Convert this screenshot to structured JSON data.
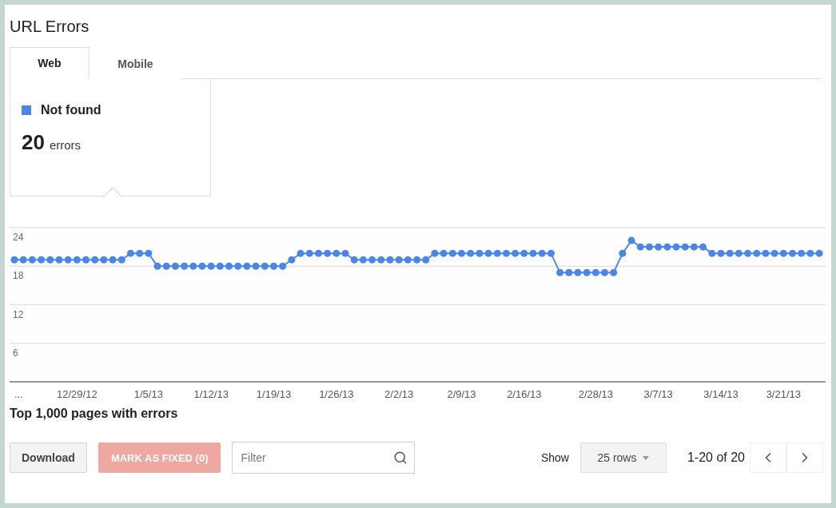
{
  "title": "URL Errors",
  "tabs": [
    {
      "label": "Web",
      "selected": true
    },
    {
      "label": "Mobile",
      "selected": false
    }
  ],
  "legend": {
    "count": "20",
    "unit": "errors"
  },
  "chart_data": {
    "type": "line",
    "grid": true,
    "ylim": [
      0,
      24
    ],
    "yticks": [
      6,
      12,
      18,
      24
    ],
    "categories": [
      "...",
      null,
      null,
      null,
      null,
      null,
      null,
      "12/29/12",
      null,
      null,
      null,
      null,
      null,
      null,
      null,
      "1/5/13",
      null,
      null,
      null,
      null,
      null,
      null,
      "1/12/13",
      null,
      null,
      null,
      null,
      null,
      null,
      "1/19/13",
      null,
      null,
      null,
      null,
      null,
      null,
      "1/26/13",
      null,
      null,
      null,
      null,
      null,
      null,
      "2/2/13",
      null,
      null,
      null,
      null,
      null,
      null,
      "2/9/13",
      null,
      null,
      null,
      null,
      null,
      null,
      "2/16/13",
      null,
      null,
      null,
      null,
      null,
      null,
      null,
      "2/28/13",
      null,
      null,
      null,
      null,
      null,
      null,
      "3/7/13",
      null,
      null,
      null,
      null,
      null,
      null,
      "3/14/13",
      null,
      null,
      null,
      null,
      null,
      null,
      "3/21/13",
      null,
      null,
      null,
      null
    ],
    "series": [
      {
        "name": "Not found",
        "color": "#4a86e8",
        "marker": "circle",
        "values": [
          19,
          19,
          19,
          19,
          19,
          19,
          19,
          19,
          19,
          19,
          19,
          19,
          19,
          20,
          20,
          20,
          18,
          18,
          18,
          18,
          18,
          18,
          18,
          18,
          18,
          18,
          18,
          18,
          18,
          18,
          18,
          19,
          20,
          20,
          20,
          20,
          20,
          20,
          19,
          19,
          19,
          19,
          19,
          19,
          19,
          19,
          19,
          20,
          20,
          20,
          20,
          20,
          20,
          20,
          20,
          20,
          20,
          20,
          20,
          20,
          20,
          17,
          17,
          17,
          17,
          17,
          17,
          17,
          20,
          22,
          21,
          21,
          21,
          21,
          21,
          21,
          21,
          21,
          20,
          20,
          20,
          20,
          20,
          20,
          20,
          20,
          20,
          20,
          20,
          20,
          20
        ]
      }
    ]
  },
  "table_title": "Top 1,000 pages with errors",
  "toolbar": {
    "download": "Download",
    "mark_fixed": {
      "label": "MARK AS FIXED (0)",
      "disabled": true
    },
    "filter": {
      "placeholder": "Filter"
    },
    "show_label": "Show",
    "rows_select": "25 rows",
    "range": "1-20 of 20"
  }
}
